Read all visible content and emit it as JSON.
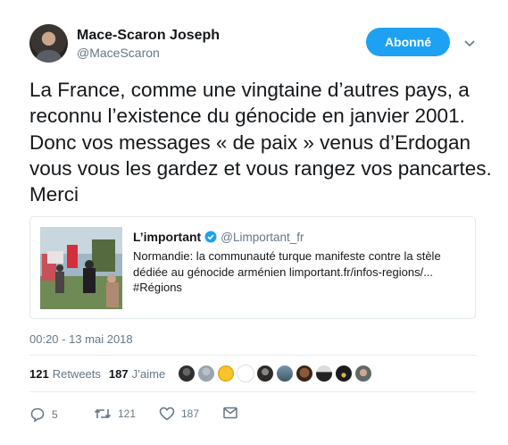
{
  "author": {
    "name": "Mace-Scaron Joseph",
    "handle": "@MaceScaron"
  },
  "follow_button": {
    "label": "Abonné"
  },
  "menu_icon": "chevron-down-icon",
  "tweet_text": "La France, comme une vingtaine d’autres pays, a reconnu l’existence du génocide en janvier 2001. Donc vos messages « de paix » venus d’Erdogan vous vous les gardez et vous rangez vos pancartes. Merci",
  "quoted": {
    "name": "L’important",
    "verified_icon": "verified-badge-icon",
    "handle": "@Limportant_fr",
    "text": "Normandie: la communauté turque manifeste contre la stèle dédiée au génocide arménien limportant.fr/infos-regions/... #Régions"
  },
  "timestamp": "00:20 - 13 mai 2018",
  "stats": {
    "retweets_count": "121",
    "retweets_label": "Retweets",
    "likes_count": "187",
    "likes_label": "J’aime"
  },
  "likers_count_shown": 10,
  "actions": {
    "reply_count": "5",
    "retweet_count": "121",
    "like_count": "187"
  },
  "colors": {
    "accent": "#1da1f2",
    "secondary_text": "#657786",
    "border": "#e1e8ed"
  }
}
